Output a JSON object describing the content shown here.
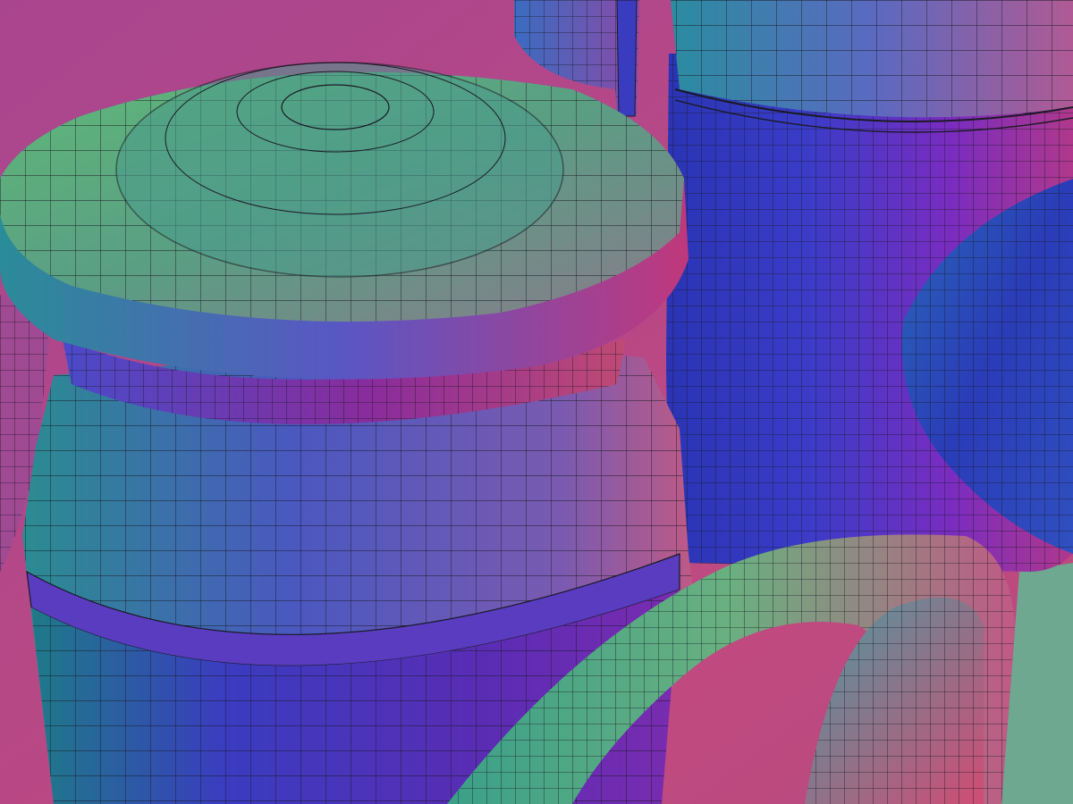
{
  "scene": {
    "description_visible_text": "",
    "colors": {
      "background_magenta": "#b04a8c",
      "background_teal": "#6fa890",
      "green": "#5fb878",
      "teal": "#2c8c9c",
      "blue": "#3048c8",
      "violet": "#6a2cc0",
      "magenta": "#c0387c",
      "pink": "#d0507c",
      "wire": "#1a1a24"
    }
  }
}
